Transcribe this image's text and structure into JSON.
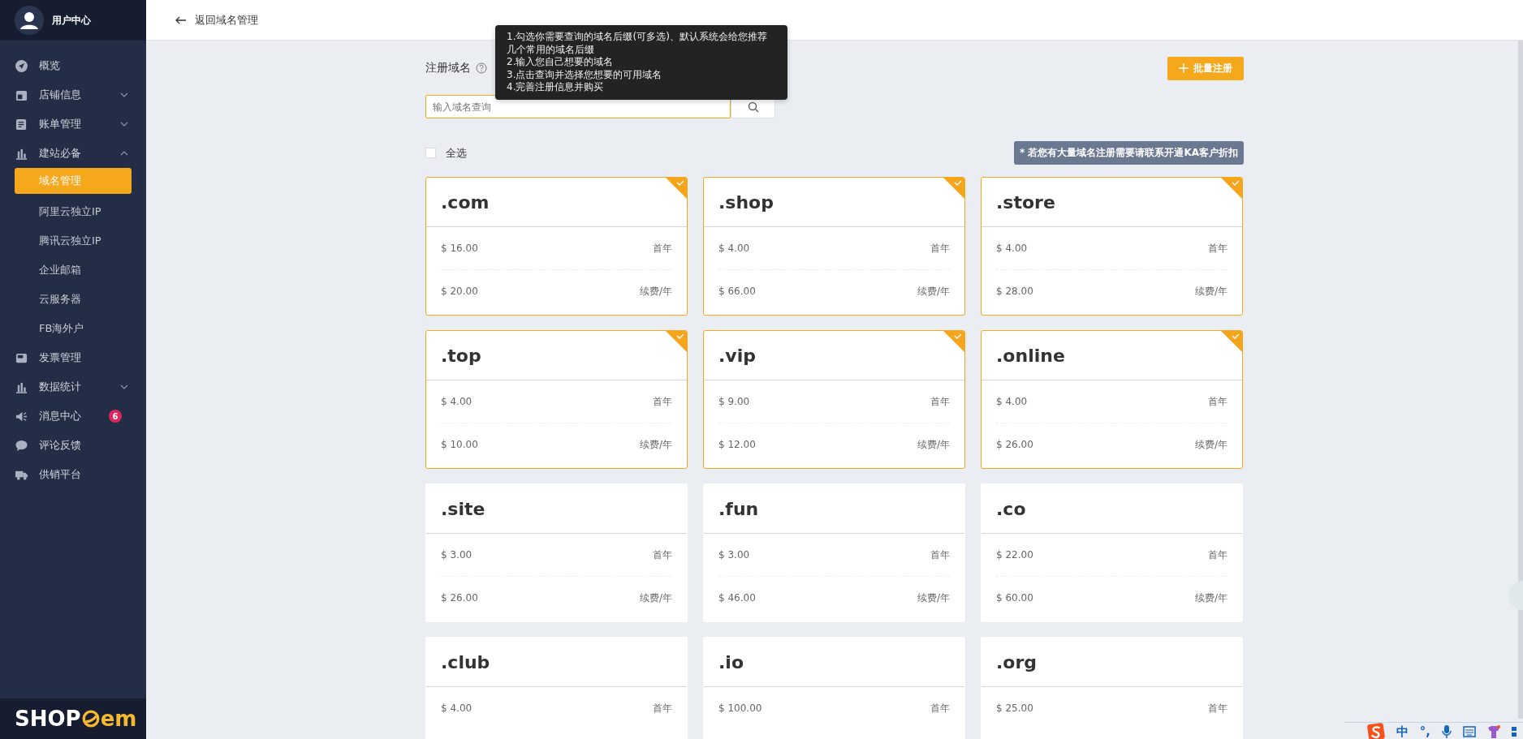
{
  "sidebar": {
    "user": {
      "name": "用户中心"
    },
    "items": [
      {
        "label": "概览"
      },
      {
        "label": "店铺信息",
        "expanded": false
      },
      {
        "label": "账单管理",
        "expanded": false
      },
      {
        "label": "建站必备",
        "expanded": true,
        "children": [
          {
            "label": "域名管理",
            "selected": true
          },
          {
            "label": "阿里云独立IP",
            "selected": false
          },
          {
            "label": "腾讯云独立IP",
            "selected": false
          },
          {
            "label": "企业邮箱",
            "selected": false
          },
          {
            "label": "云服务器",
            "selected": false
          },
          {
            "label": "FB海外户",
            "selected": false
          }
        ]
      },
      {
        "label": "发票管理"
      },
      {
        "label": "数据统计",
        "expanded": false
      },
      {
        "label": "消息中心",
        "badge": "6"
      },
      {
        "label": "评论反馈"
      },
      {
        "label": "供销平台"
      }
    ],
    "logo": {
      "prefix": "SHOP",
      "suffix": "em"
    }
  },
  "header": {
    "back_link": "返回域名管理"
  },
  "register": {
    "label": "注册域名",
    "batch_button": "批量注册",
    "tooltip": [
      "1.勾选你需要查询的域名后缀(可多选)、默认系统会给您推荐几个常用的域名后缀",
      "2.输入您自己想要的域名",
      "3.点击查询并选择您想要的可用域名",
      "4.完善注册信息并购买"
    ],
    "search": {
      "placeholder": "输入域名查询"
    },
    "select_all": {
      "label": "全选",
      "checked": false
    },
    "notice": "* 若您有大量域名注册需要请联系开通KA客户折扣"
  },
  "domains": [
    {
      "name": ".com",
      "selected": true,
      "prices": [
        {
          "amount": "$ 16.00",
          "term": "首年"
        },
        {
          "amount": "$ 20.00",
          "term": "续费/年"
        }
      ]
    },
    {
      "name": ".shop",
      "selected": true,
      "prices": [
        {
          "amount": "$ 4.00",
          "term": "首年"
        },
        {
          "amount": "$ 66.00",
          "term": "续费/年"
        }
      ]
    },
    {
      "name": ".store",
      "selected": true,
      "prices": [
        {
          "amount": "$ 4.00",
          "term": "首年"
        },
        {
          "amount": "$ 28.00",
          "term": "续费/年"
        }
      ]
    },
    {
      "name": ".top",
      "selected": true,
      "prices": [
        {
          "amount": "$ 4.00",
          "term": "首年"
        },
        {
          "amount": "$ 10.00",
          "term": "续费/年"
        }
      ]
    },
    {
      "name": ".vip",
      "selected": true,
      "prices": [
        {
          "amount": "$ 9.00",
          "term": "首年"
        },
        {
          "amount": "$ 12.00",
          "term": "续费/年"
        }
      ]
    },
    {
      "name": ".online",
      "selected": true,
      "prices": [
        {
          "amount": "$ 4.00",
          "term": "首年"
        },
        {
          "amount": "$ 26.00",
          "term": "续费/年"
        }
      ]
    },
    {
      "name": ".site",
      "selected": false,
      "prices": [
        {
          "amount": "$ 3.00",
          "term": "首年"
        },
        {
          "amount": "$ 26.00",
          "term": "续费/年"
        }
      ]
    },
    {
      "name": ".fun",
      "selected": false,
      "prices": [
        {
          "amount": "$ 3.00",
          "term": "首年"
        },
        {
          "amount": "$ 46.00",
          "term": "续费/年"
        }
      ]
    },
    {
      "name": ".co",
      "selected": false,
      "prices": [
        {
          "amount": "$ 22.00",
          "term": "首年"
        },
        {
          "amount": "$ 60.00",
          "term": "续费/年"
        }
      ]
    },
    {
      "name": ".club",
      "selected": false,
      "prices": [
        {
          "amount": "$ 4.00",
          "term": "首年"
        }
      ]
    },
    {
      "name": ".io",
      "selected": false,
      "prices": [
        {
          "amount": "$ 100.00",
          "term": "首年"
        }
      ]
    },
    {
      "name": ".org",
      "selected": false,
      "prices": [
        {
          "amount": "$ 25.00",
          "term": "首年"
        }
      ]
    }
  ],
  "ime_bar": {
    "mode": "中",
    "punctuation": "°,"
  }
}
